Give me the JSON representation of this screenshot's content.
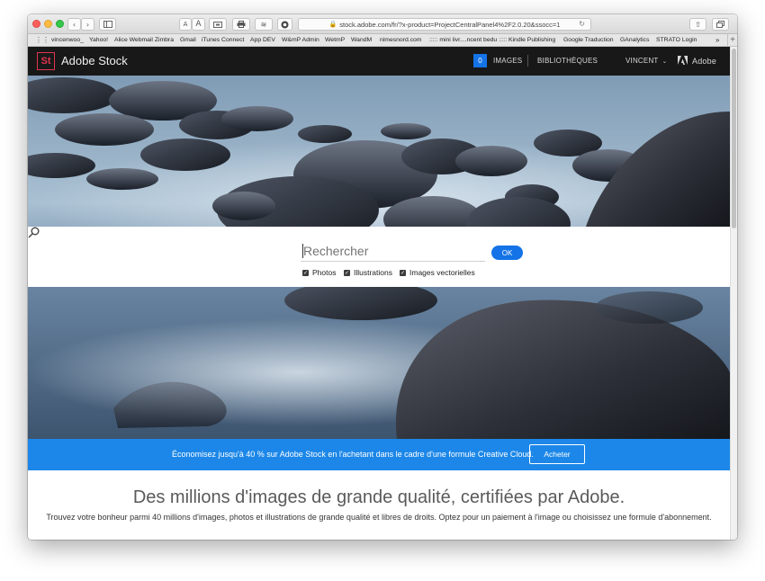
{
  "browser": {
    "url": "stock.adobe.com/fr/?x-product=ProjectCentralPanel4%2F2.0.20&ssocc=1",
    "font_small": "A",
    "font_large": "A",
    "bookmarks": [
      "vincenwoo_",
      "Yahoo!",
      "Alice Webmail Zimbra",
      "Gmail",
      "iTunes Connect",
      "App DEV",
      "W&mP Admin",
      "WetmP",
      "WandM",
      "nimesnord.com",
      "::::: mini livr....ncent bedu :::::",
      "Kindle Publishing",
      "Google Traduction",
      "GAnalytics",
      "STRATO Login"
    ],
    "bookmarks_more": "»",
    "bookmarks_add": "+"
  },
  "header": {
    "logo_mark": "St",
    "logo_text": "Adobe Stock",
    "cart_count": "0",
    "nav_images": "IMAGES",
    "nav_libraries": "BIBLIOTHÈQUES",
    "user_name": "VINCENT",
    "brand": "Adobe"
  },
  "search": {
    "placeholder": "Rechercher",
    "submit_label": "OK",
    "filters": [
      {
        "label": "Photos",
        "checked": true
      },
      {
        "label": "Illustrations",
        "checked": true
      },
      {
        "label": "Images vectorielles",
        "checked": true
      }
    ]
  },
  "promo": {
    "text": "Économisez jusqu'à 40 % sur Adobe Stock en l'achetant dans le cadre d'une formule Creative Cloud.",
    "button_label": "Acheter"
  },
  "content": {
    "headline": "Des millions d'images de grande qualité, certifiées par Adobe.",
    "subline": "Trouvez votre bonheur parmi 40 millions d'images, photos et illustrations de grande qualité et libres de droits. Optez pour un paiement à l'image ou choisissez une formule d'abonnement."
  },
  "colors": {
    "accent": "#1473e6",
    "promo_bg": "#1c87e8",
    "header_bg": "#181818",
    "logo_red": "#e0354f"
  }
}
